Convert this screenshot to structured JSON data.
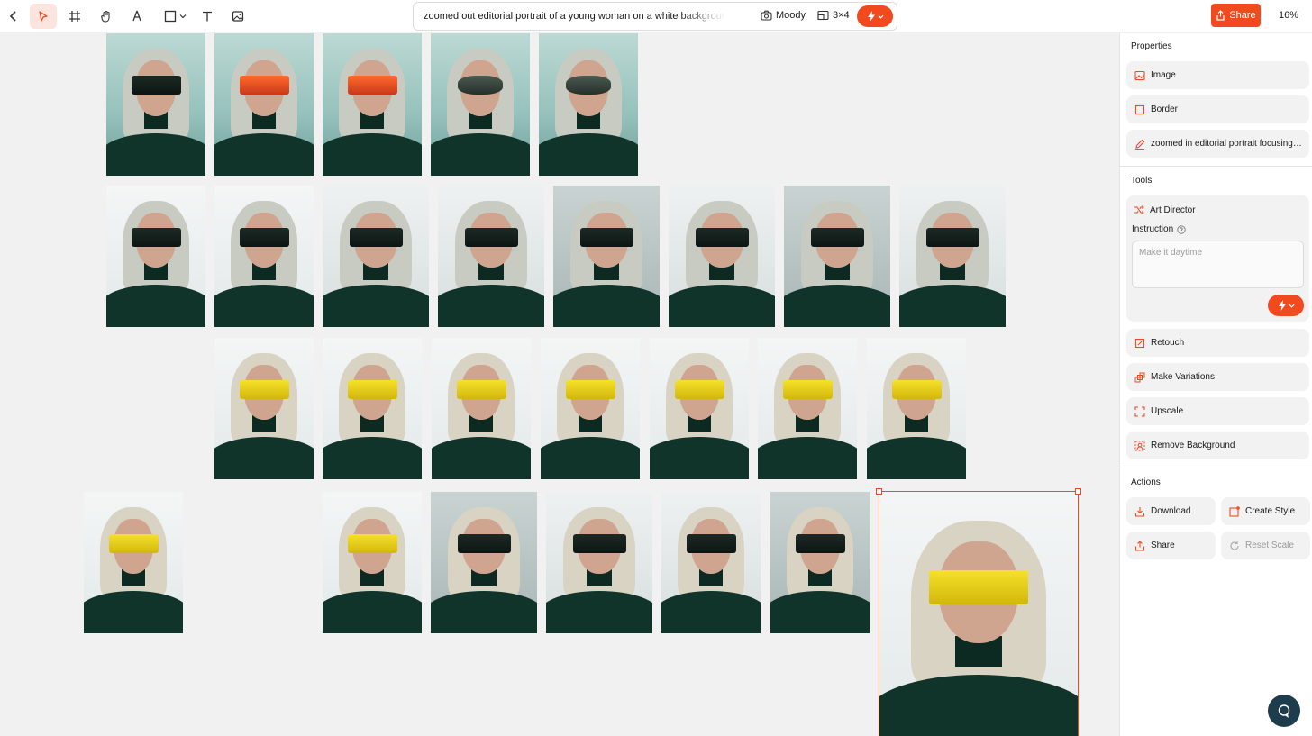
{
  "toolbar": {
    "back_icon": "chevron-left-icon",
    "tools": [
      "pointer-icon",
      "frame-icon",
      "hand-icon",
      "pen-icon",
      "rectangle-icon",
      "text-icon",
      "image-icon"
    ],
    "prompt": "zoomed out editorial portrait of a young woman on a white background, long",
    "style_label": "Moody",
    "grid_label": "3×4",
    "share_label": "Share",
    "zoom": "16%"
  },
  "canvas": {
    "image_count": 27,
    "accent": "#f24a1f"
  },
  "panel": {
    "properties_title": "Properties",
    "properties": {
      "image": "Image",
      "border": "Border",
      "prompt": "zoomed in editorial portrait focusing on the sunglasses"
    },
    "tools_title": "Tools",
    "art_director": "Art Director",
    "instruction_label": "Instruction",
    "instruction_placeholder": "Make it daytime",
    "tools": {
      "retouch": "Retouch",
      "variations": "Make Variations",
      "upscale": "Upscale",
      "remove_bg": "Remove Background"
    },
    "actions_title": "Actions",
    "actions": {
      "download": "Download",
      "create_style": "Create Style",
      "share": "Share",
      "reset_scale": "Reset Scale"
    }
  }
}
